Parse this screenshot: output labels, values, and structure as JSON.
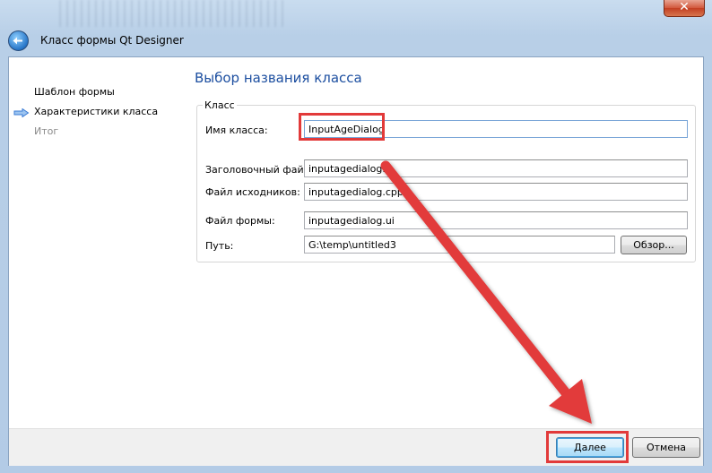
{
  "window": {
    "title": "Класс формы Qt Designer",
    "close_glyph": "✕"
  },
  "sidebar": {
    "items": [
      {
        "label": "Шаблон формы",
        "state": "done"
      },
      {
        "label": "Характеристики класса",
        "state": "current"
      },
      {
        "label": "Итог",
        "state": "pending"
      }
    ]
  },
  "page": {
    "heading": "Выбор названия класса",
    "group_title": "Класс",
    "fields": {
      "class_name": {
        "label": "Имя класса:",
        "value": "InputAgeDialog"
      },
      "header_file": {
        "label": "Заголовочный файл:",
        "value": "inputagedialog.h"
      },
      "source_file": {
        "label": "Файл исходников:",
        "value": "inputagedialog.cpp"
      },
      "form_file": {
        "label": "Файл формы:",
        "value": "inputagedialog.ui"
      },
      "path": {
        "label": "Путь:",
        "value": "G:\\temp\\untitled3"
      }
    },
    "browse_label": "Обзор..."
  },
  "footer": {
    "next_label": "Далее",
    "cancel_label": "Отмена"
  },
  "colors": {
    "heading": "#1d4fa0",
    "annotation": "#e23a3a",
    "sidebar_arrow": "#3a7bd5"
  },
  "icons": {
    "back": "back-arrow-icon",
    "current_step": "step-arrow-icon",
    "close": "close-icon"
  }
}
